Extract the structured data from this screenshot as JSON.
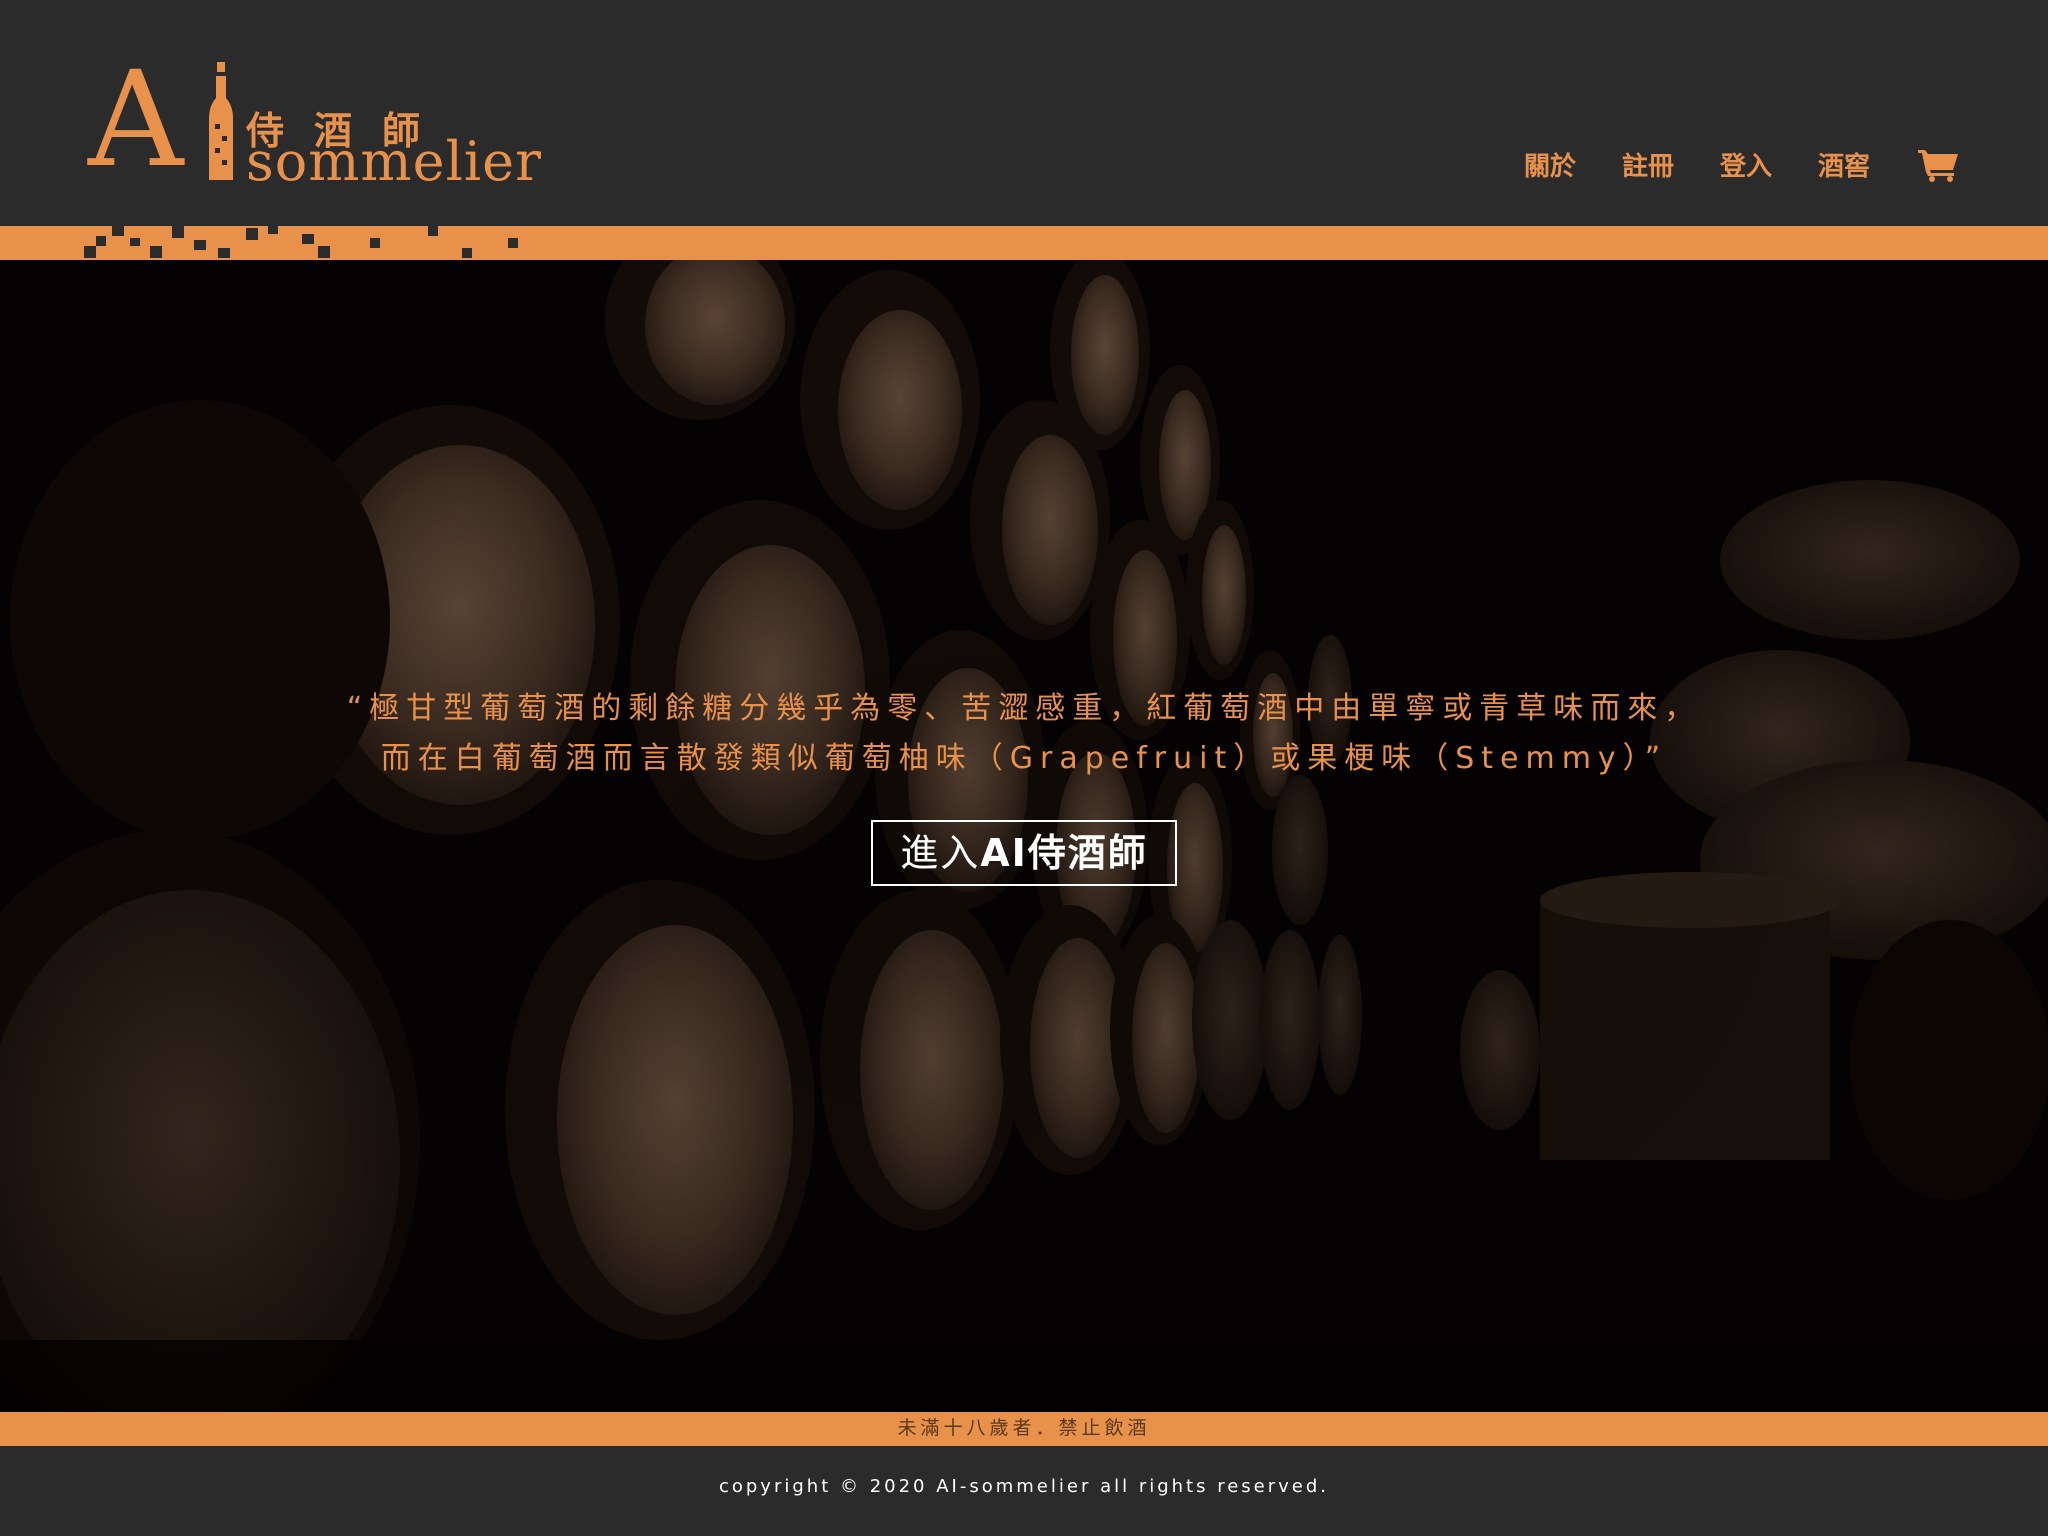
{
  "header": {
    "logo": {
      "mark": "A",
      "name_zh": "侍酒師",
      "name_en": "sommelier"
    },
    "nav": [
      {
        "label": "關於"
      },
      {
        "label": "註冊"
      },
      {
        "label": "登入"
      },
      {
        "label": "酒窖"
      }
    ],
    "cart_icon": "shopping-cart-icon"
  },
  "hero": {
    "quote_line1": "“極甘型葡萄酒的剩餘糖分幾乎為零、苦澀感重，紅葡萄酒中由單寧或青草味而來，",
    "quote_line2": "而在白葡萄酒而言散發類似葡萄柚味（Grapefruit）或果梗味（Stemmy）”",
    "button_prefix": "進入",
    "button_bold": "AI侍酒師"
  },
  "footer": {
    "age_warning": "未滿十八歲者．禁止飲酒",
    "copyright": "copyright © 2020 AI-sommelier all rights reserved."
  },
  "colors": {
    "accent": "#e8914a",
    "header_bg": "#2c2b2c",
    "hero_bg": "#070404"
  }
}
